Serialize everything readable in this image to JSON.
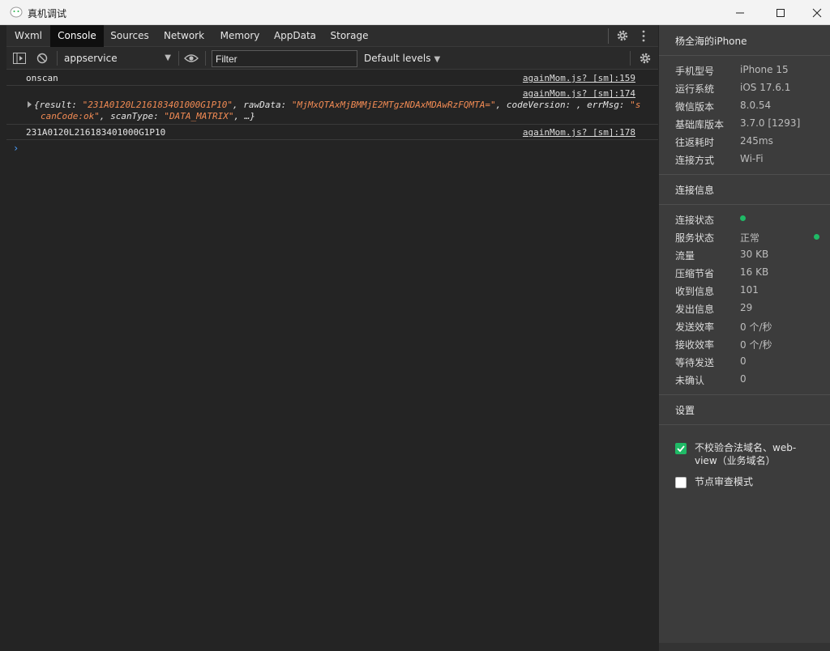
{
  "window": {
    "title": "真机调试"
  },
  "tabs": [
    {
      "label": "Wxml"
    },
    {
      "label": "Console"
    },
    {
      "label": "Sources"
    },
    {
      "label": "Network"
    },
    {
      "label": "Memory"
    },
    {
      "label": "AppData"
    },
    {
      "label": "Storage"
    }
  ],
  "active_tab": "Console",
  "toolbar": {
    "context": "appservice",
    "filter_placeholder": "Filter",
    "levels": "Default levels"
  },
  "console": {
    "entries": [
      {
        "text": "onscan",
        "source": "againMom.js? [sm]:159"
      },
      {
        "source": "againMom.js? [sm]:174"
      },
      {
        "text": "231A0120L216183401000G1P10",
        "source": "againMom.js? [sm]:178"
      }
    ],
    "object": {
      "k1": "{result: ",
      "v1": "\"231A0120L216183401000G1P10\"",
      "k2": ", rawData: ",
      "v2": "\"MjMxQTAxMjBMMjE2MTgzNDAxMDAwRzFQMTA=\"",
      "k3": ", codeVersion: , errMsg: ",
      "v3a": "\"s",
      "v3b": "canCode:ok\"",
      "k4": ", scanType: ",
      "v4": "\"DATA_MATRIX\"",
      "k5": ", …}"
    },
    "prompt": "›"
  },
  "device": {
    "name": "杨全海的iPhone",
    "info": [
      {
        "label": "手机型号",
        "value": "iPhone 15"
      },
      {
        "label": "运行系统",
        "value": "iOS 17.6.1"
      },
      {
        "label": "微信版本",
        "value": "8.0.54"
      },
      {
        "label": "基础库版本",
        "value": "3.7.0 [1293]"
      },
      {
        "label": "往返耗时",
        "value": "245ms"
      },
      {
        "label": "连接方式",
        "value": "Wi-Fi"
      }
    ]
  },
  "connection": {
    "title": "连接信息",
    "rows": [
      {
        "label": "连接状态",
        "value": ""
      },
      {
        "label": "服务状态",
        "value": "正常"
      },
      {
        "label": "流量",
        "value": "30 KB"
      },
      {
        "label": "压缩节省",
        "value": "16 KB"
      },
      {
        "label": "收到信息",
        "value": "101"
      },
      {
        "label": "发出信息",
        "value": "29"
      },
      {
        "label": "发送效率",
        "value": "0 个/秒"
      },
      {
        "label": "接收效率",
        "value": "0 个/秒"
      },
      {
        "label": "等待发送",
        "value": "0"
      },
      {
        "label": "未确认",
        "value": "0"
      }
    ],
    "status_color": "#1fba66"
  },
  "settings": {
    "title": "设置",
    "options": [
      {
        "label": "不校验合法域名、web-view（业务域名）",
        "checked": true
      },
      {
        "label": "节点审查模式",
        "checked": false
      }
    ]
  }
}
